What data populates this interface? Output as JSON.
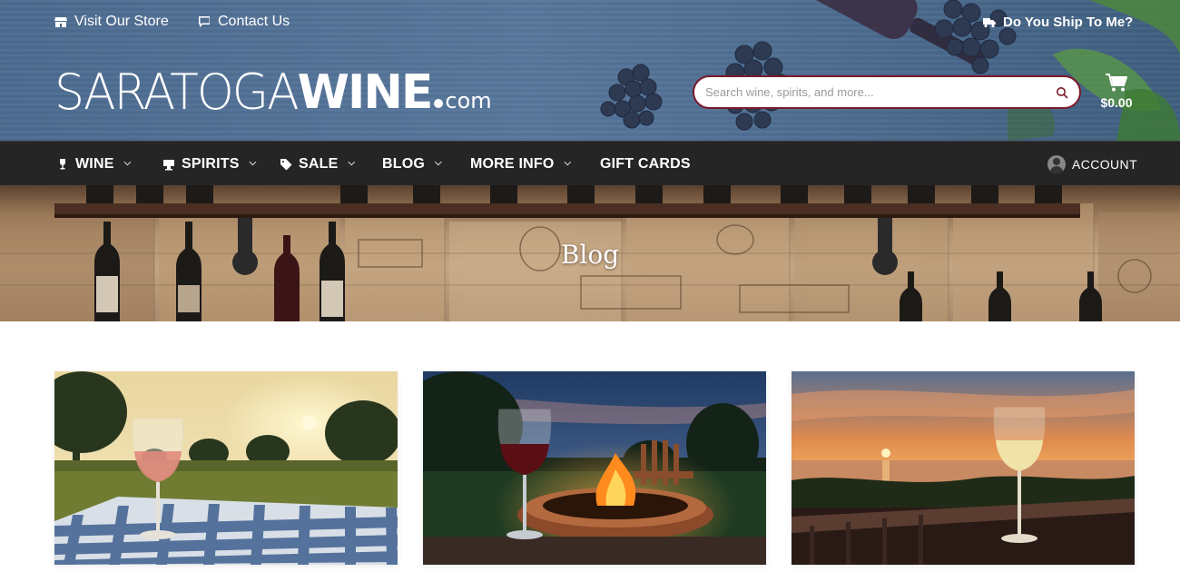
{
  "topbar": {
    "store_link": "Visit Our Store",
    "contact_link": "Contact Us",
    "ship_link": "Do You Ship To Me?"
  },
  "logo": {
    "part1": "SARATOGA",
    "part2": "WINE",
    "part3": "com"
  },
  "search": {
    "placeholder": "Search wine, spirits, and more...",
    "value": ""
  },
  "cart": {
    "total": "$0.00"
  },
  "nav": {
    "items": [
      {
        "label": "WINE",
        "icon": "wine-glass-icon",
        "has_dropdown": true
      },
      {
        "label": "SPIRITS",
        "icon": "bar-icon",
        "has_dropdown": true
      },
      {
        "label": "SALE",
        "icon": "tag-icon",
        "has_dropdown": true
      },
      {
        "label": "BLOG",
        "icon": "",
        "has_dropdown": true
      },
      {
        "label": "MORE INFO",
        "icon": "",
        "has_dropdown": true
      },
      {
        "label": "GIFT CARDS",
        "icon": "",
        "has_dropdown": false
      }
    ],
    "account": "ACCOUNT"
  },
  "hero": {
    "title": "Blog"
  },
  "posts": [
    {
      "image": "rose-wine-picnic-sunset"
    },
    {
      "image": "red-wine-firepit-dusk"
    },
    {
      "image": "white-wine-lake-sunset"
    }
  ],
  "colors": {
    "header_blue": "#4f6f93",
    "nav_dark": "#252525",
    "search_border": "#7a1a2a",
    "white": "#ffffff"
  }
}
